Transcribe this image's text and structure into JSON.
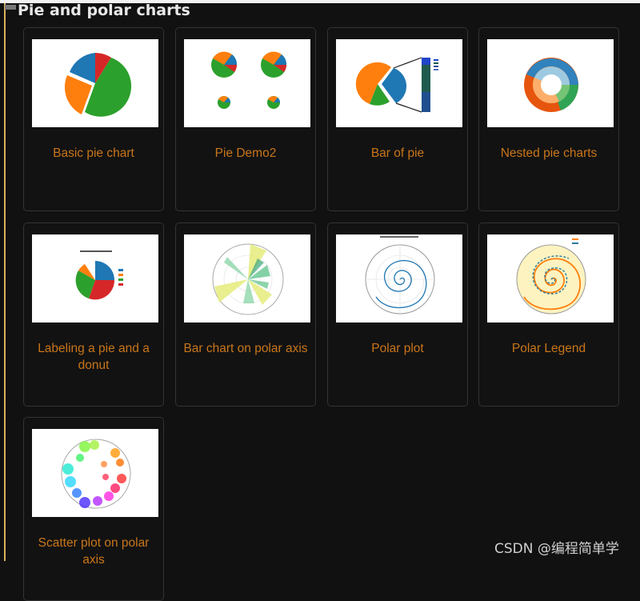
{
  "section": {
    "title": "Pie and polar charts"
  },
  "cards": [
    {
      "label": "Basic pie chart",
      "thumb": "basic-pie"
    },
    {
      "label": "Pie Demo2",
      "thumb": "pie-demo2"
    },
    {
      "label": "Bar of pie",
      "thumb": "bar-of-pie"
    },
    {
      "label": "Nested pie charts",
      "thumb": "nested-pie"
    },
    {
      "label": "Labeling a pie and a donut",
      "thumb": "labeling-pie"
    },
    {
      "label": "Bar chart on polar axis",
      "thumb": "polar-bar"
    },
    {
      "label": "Polar plot",
      "thumb": "polar-plot"
    },
    {
      "label": "Polar Legend",
      "thumb": "polar-legend"
    },
    {
      "label": "Scatter plot on polar axis",
      "thumb": "polar-scatter"
    }
  ],
  "watermark": "CSDN @编程简单学",
  "colors": {
    "link": "#c9761a",
    "background": "#111111",
    "card_border": "#333333"
  }
}
